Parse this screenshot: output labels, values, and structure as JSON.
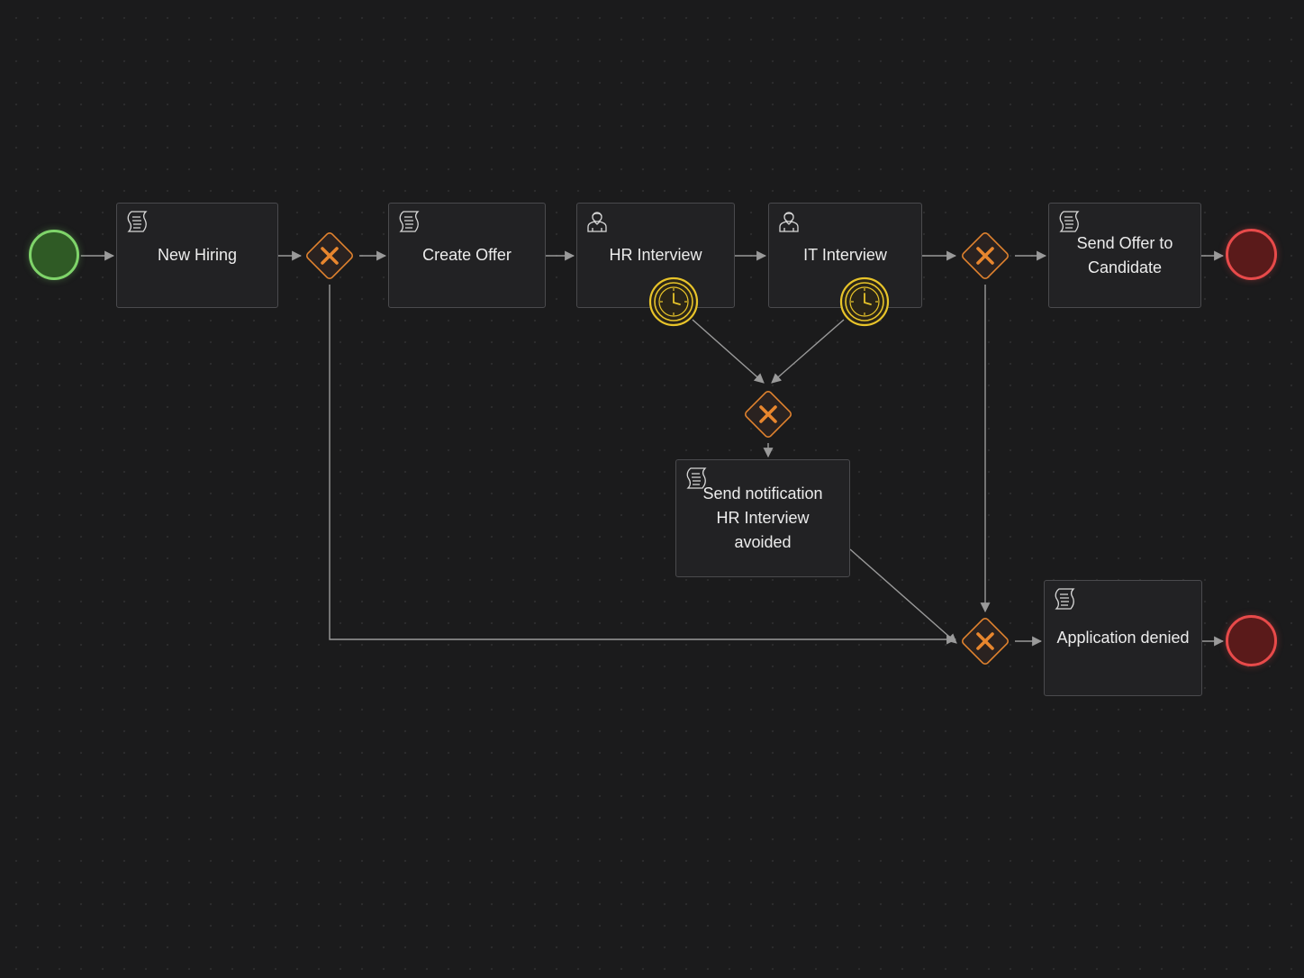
{
  "diagram": {
    "tasks": {
      "new_hiring": "New Hiring",
      "create_offer": "Create Offer",
      "hr_interview": "HR Interview",
      "it_interview": "IT Interview",
      "send_offer": [
        "Send Offer to",
        "Candidate"
      ],
      "send_notification": [
        "Send notification",
        "HR Interview",
        "avoided"
      ],
      "application_denied": "Application denied"
    },
    "task_types": {
      "new_hiring": "script-icon",
      "create_offer": "script-icon",
      "hr_interview": "user-icon",
      "it_interview": "user-icon",
      "send_offer": "script-icon",
      "send_notification": "script-icon",
      "application_denied": "script-icon"
    },
    "gateway_icon": "exclusive-gateway-icon",
    "timer_icon": "clock-icon",
    "colors": {
      "background": "#1b1b1c",
      "task_fill": "#222224",
      "task_border": "#4a4a4d",
      "start_event": "#7fd46a",
      "end_event": "#e84a4a",
      "gateway": "#e0822e",
      "timer": "#e8c42a",
      "flow": "#9a9a9a",
      "text": "#ececec"
    }
  }
}
